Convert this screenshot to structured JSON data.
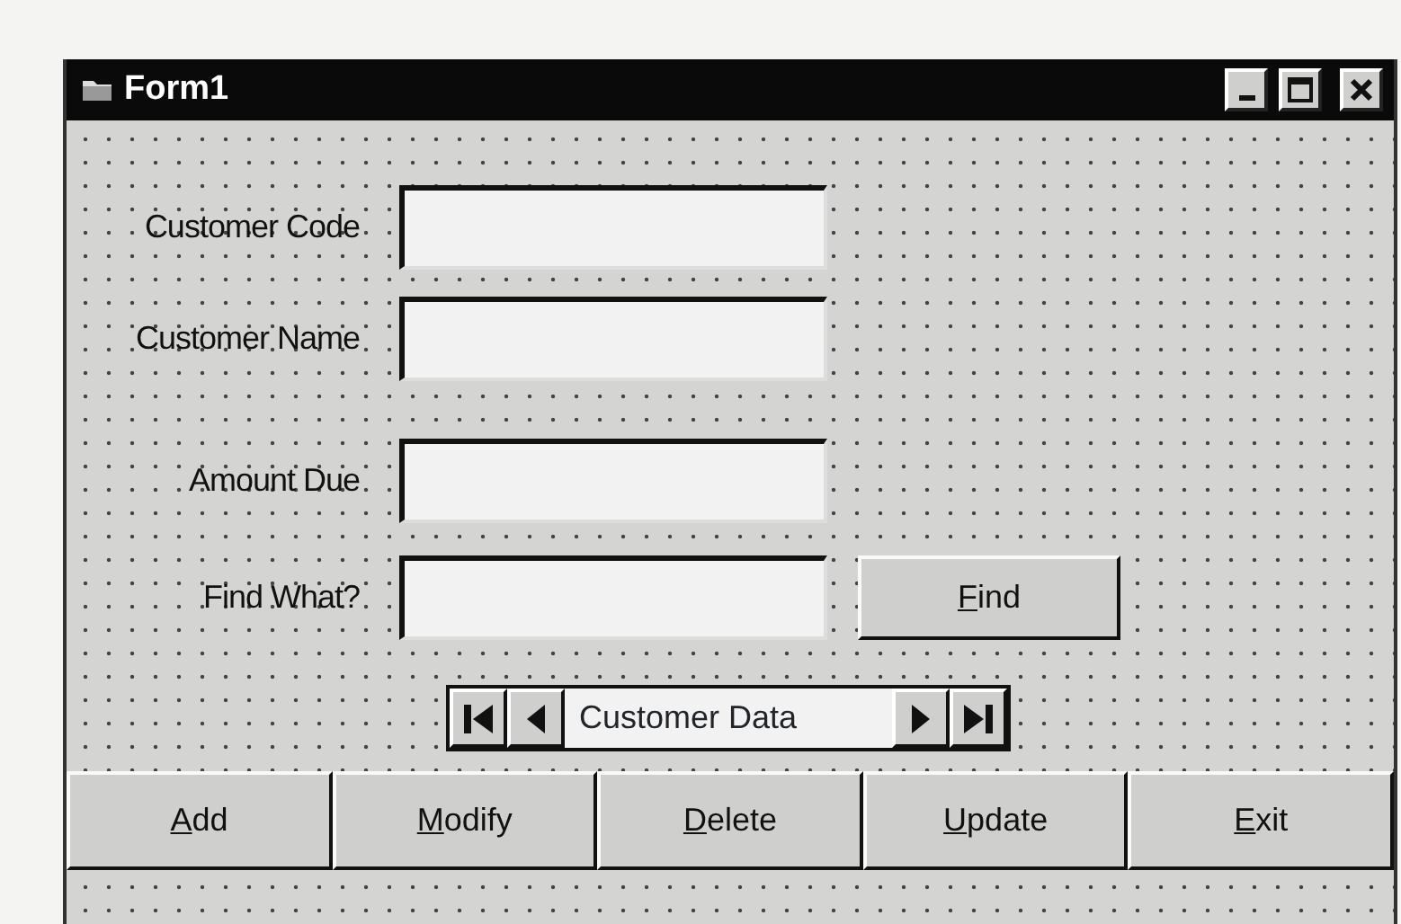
{
  "window": {
    "title": "Form1"
  },
  "fields": [
    {
      "label": "Customer Code"
    },
    {
      "label": "Customer Name"
    },
    {
      "label": "Amount Due"
    },
    {
      "label": "Find What?"
    }
  ],
  "find_button": {
    "label": "Find",
    "access_key_underlined": true
  },
  "data_control": {
    "caption": "Customer Data"
  },
  "buttons": [
    {
      "label": "Add",
      "access_key_underlined": true
    },
    {
      "label": "Modify",
      "access_key_underlined": true
    },
    {
      "label": "Delete",
      "access_key_underlined": true
    },
    {
      "label": "Update",
      "access_key_underlined": true
    },
    {
      "label": "Exit",
      "access_key_underlined": true
    }
  ]
}
